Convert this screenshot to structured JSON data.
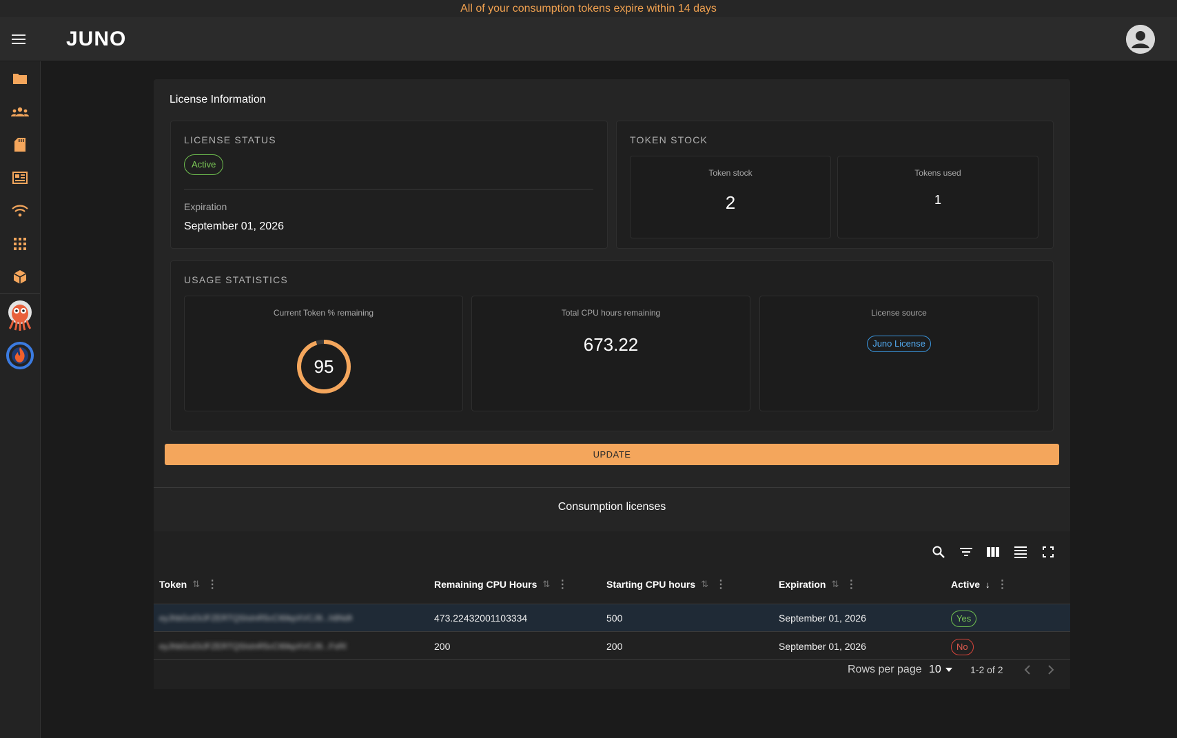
{
  "banner": {
    "text": "All of your consumption tokens expire within 14 days"
  },
  "header": {
    "logo_text": "JUNO",
    "menu_icon": "hamburger-icon",
    "avatar_icon": "account-circle-icon"
  },
  "sidebar": {
    "items": [
      {
        "name": "folder",
        "icon": "folder-icon"
      },
      {
        "name": "groups",
        "icon": "groups-icon"
      },
      {
        "name": "storage",
        "icon": "sd-card-icon"
      },
      {
        "name": "dashboard",
        "icon": "newspaper-icon"
      },
      {
        "name": "network",
        "icon": "wifi-icon"
      },
      {
        "name": "apps",
        "icon": "apps-grid-icon"
      },
      {
        "name": "packages",
        "icon": "package-icon"
      },
      {
        "name": "argo",
        "icon": "argo-octopus-icon"
      },
      {
        "name": "spark",
        "icon": "flame-wheel-icon"
      }
    ]
  },
  "license": {
    "title": "License Information",
    "status": {
      "heading": "LICENSE STATUS",
      "value": "Active",
      "expiration_label": "Expiration",
      "expiration_value": "September 01, 2026"
    },
    "token_stock": {
      "heading": "TOKEN STOCK",
      "stock_label": "Token stock",
      "stock_value": "2",
      "used_label": "Tokens used",
      "used_value": "1"
    },
    "usage": {
      "heading": "USAGE STATISTICS",
      "token_pct_label": "Current Token % remaining",
      "token_pct_value": "95",
      "token_pct_fraction": 0.95,
      "cpu_label": "Total CPU hours remaining",
      "cpu_value": "673.22",
      "source_label": "License source",
      "source_value": "Juno License"
    },
    "update_label": "UPDATE"
  },
  "consumption": {
    "title": "Consumption licenses",
    "columns": [
      "Token",
      "Remaining CPU Hours",
      "Starting CPU hours",
      "Expiration",
      "Active"
    ],
    "rows": [
      {
        "token": "eyJhbGciOiJFZERTQSIsInR5cCI6IkpXVCJ9...h8NdMdMRVt0KCw",
        "remaining": "473.22432001103334",
        "starting": "500",
        "expiration": "September 01, 2026",
        "active": "Yes"
      },
      {
        "token": "eyJhbGciOiJFZERTQSIsInR5cCI6IkpXVCJ9...FsR0Pl_M7-7xOQ",
        "remaining": "200",
        "starting": "200",
        "expiration": "September 01, 2026",
        "active": "No"
      }
    ],
    "rows_per_page_label": "Rows per page",
    "rows_per_page_value": "10",
    "range_text": "1-2 of 2"
  },
  "colors": {
    "accent": "#f4a65c",
    "active_green": "#7ccb57",
    "inactive_red": "#e25c50",
    "link_blue": "#52aaf0"
  }
}
